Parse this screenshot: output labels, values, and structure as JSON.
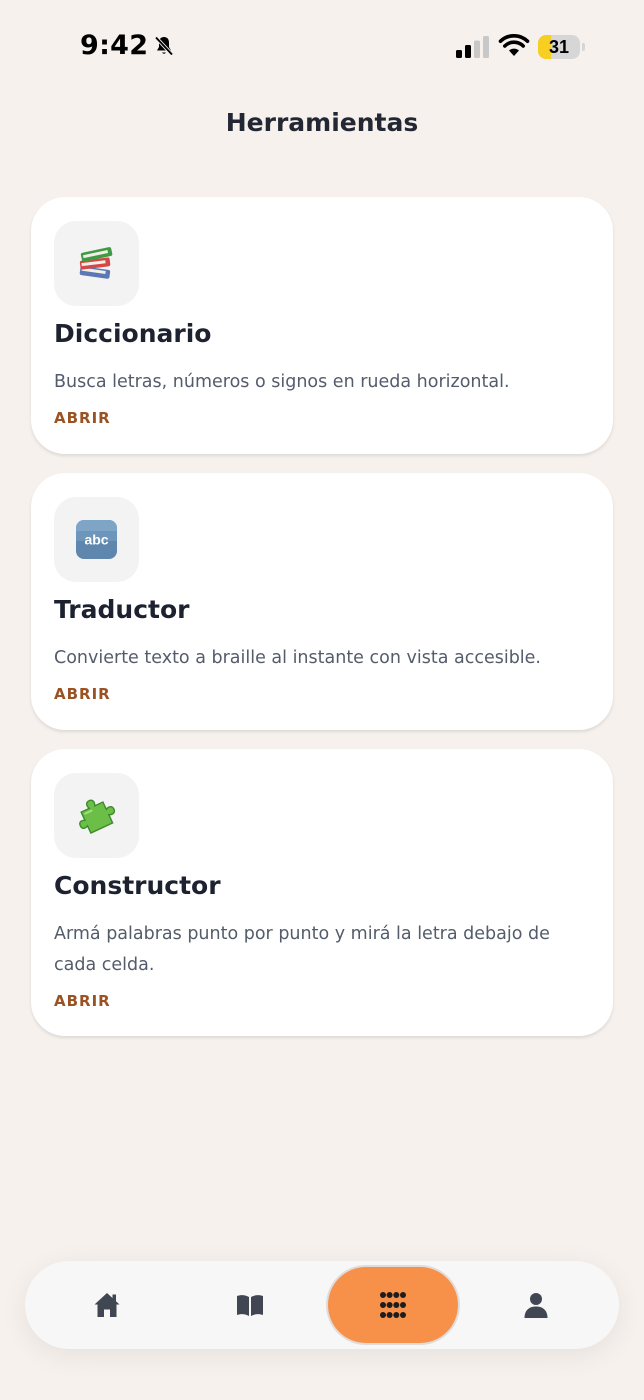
{
  "status_bar": {
    "time": "9:42",
    "battery_level": "31",
    "battery_fraction": 0.31
  },
  "header": {
    "title": "Herramientas"
  },
  "tools": [
    {
      "icon": "books-icon",
      "title": "Diccionario",
      "description": "Busca letras, números o signos en rueda horizontal.",
      "action": "ABRIR"
    },
    {
      "icon": "abc-icon",
      "title": "Traductor",
      "description": "Convierte texto a braille al instante con vista accesible.",
      "action": "ABRIR"
    },
    {
      "icon": "puzzle-piece-icon",
      "title": "Constructor",
      "description": "Armá palabras punto por punto y mirá la letra debajo de cada celda.",
      "action": "ABRIR"
    }
  ],
  "tab_bar": {
    "items": [
      {
        "icon": "home-icon",
        "active": false
      },
      {
        "icon": "book-icon",
        "active": false
      },
      {
        "icon": "grid-icon",
        "active": true
      },
      {
        "icon": "user-icon",
        "active": false
      }
    ]
  },
  "colors": {
    "background": "#f6f1ed",
    "accent": "#f7914a",
    "link": "#9a5222",
    "title": "#1d2230",
    "battery": "#f6cf22"
  }
}
